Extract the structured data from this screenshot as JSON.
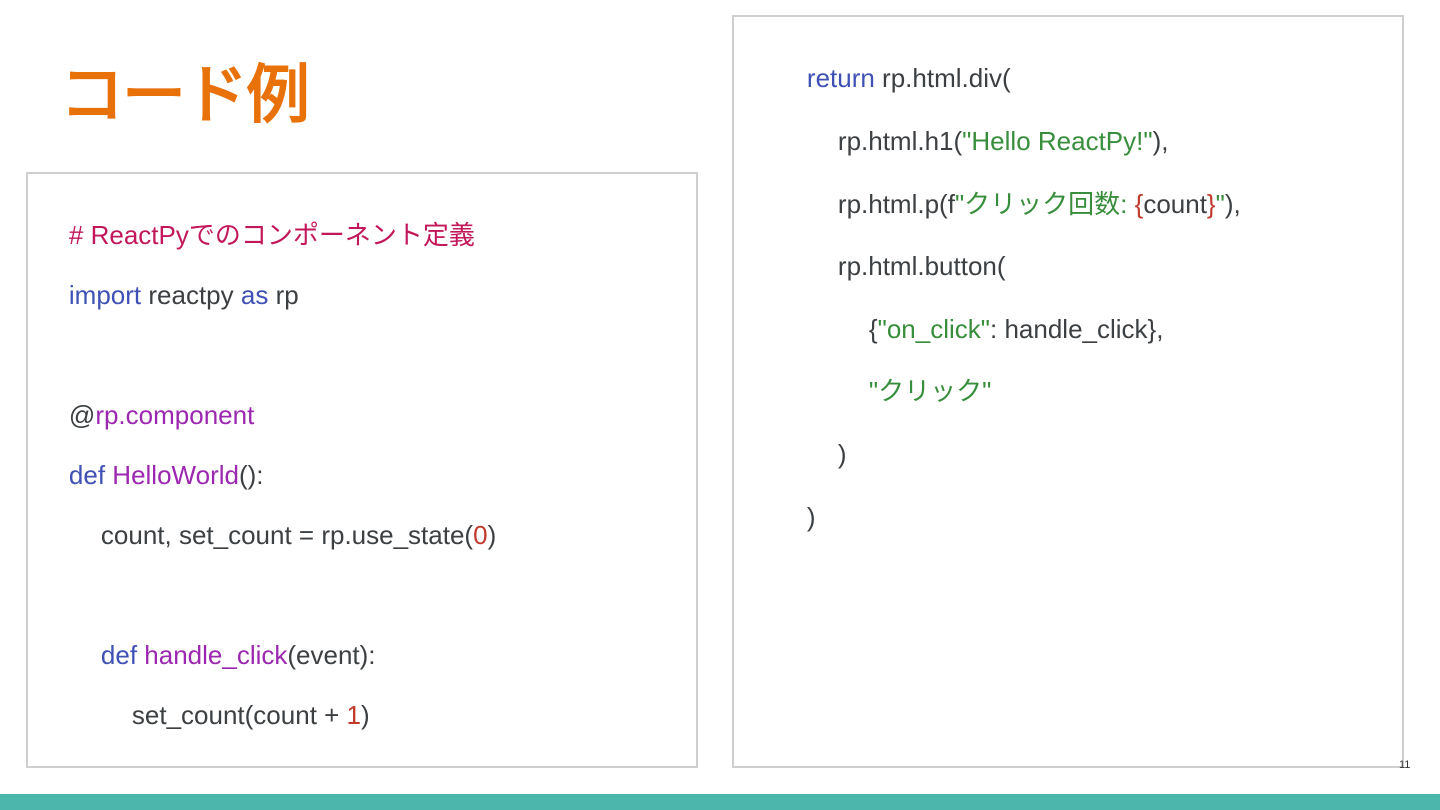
{
  "slide": {
    "title": "コード例",
    "page_number": "11"
  },
  "left_code": {
    "line1": {
      "comment": "# ReactPyでのコンポーネント定義"
    },
    "line2": {
      "kw_import": "import",
      "module": " reactpy ",
      "kw_as": "as",
      "alias": " rp"
    },
    "line3": {
      "at": "@",
      "decorator": "rp.component"
    },
    "line4": {
      "kw_def": "def",
      "space": " ",
      "name": "HelloWorld",
      "rest": "():"
    },
    "line5": {
      "text": "count, set_count = rp.use_state(",
      "num": "0",
      "close": ")"
    },
    "line6": {
      "kw_def": "def",
      "space": " ",
      "name": "handle_click",
      "rest": "(event):"
    },
    "line7": {
      "text": "set_count(count + ",
      "num": "1",
      "close": ")"
    }
  },
  "right_code": {
    "line1": {
      "kw_return": "return",
      "rest": " rp.html.div("
    },
    "line2": {
      "pre": "rp.html.h1(",
      "str": "\"Hello ReactPy!\"",
      "post": "),"
    },
    "line3": {
      "pre": "rp.html.p(f",
      "str": "\"クリック回数: ",
      "brace_open": "{",
      "var": "count",
      "brace_close": "}",
      "str_end": "\"",
      "post": "),"
    },
    "line4": {
      "text": "rp.html.button("
    },
    "line5": {
      "pre": "{",
      "str": "\"on_click\"",
      "post": ": handle_click},"
    },
    "line6": {
      "str": "\"クリック\""
    },
    "line7": {
      "text": ")"
    },
    "line8": {
      "text": ")"
    }
  }
}
